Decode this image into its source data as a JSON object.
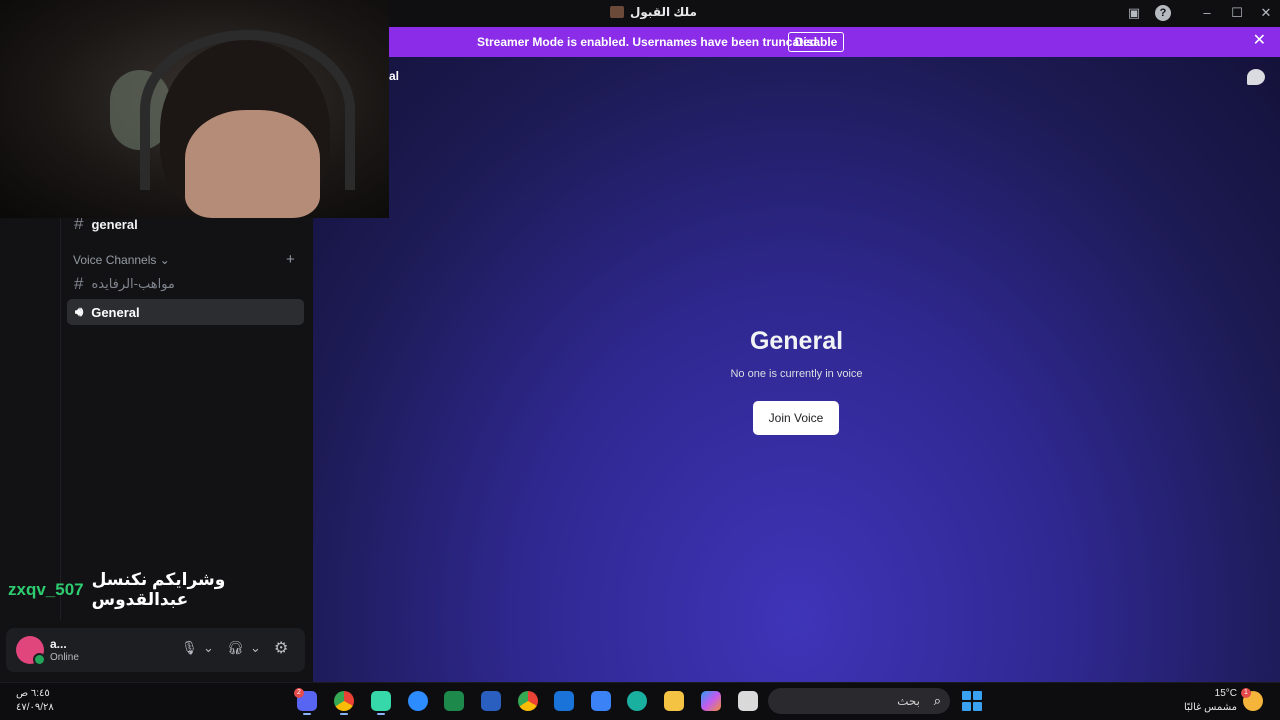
{
  "window": {
    "title": "ملك القبول"
  },
  "banner": {
    "message": "Streamer Mode is enabled. Usernames have been truncated.",
    "disable_label": "Disable",
    "color": "#8a2ce8"
  },
  "sidebar": {
    "text_channel": "general",
    "voice_header": "Voice Channels",
    "channels": [
      {
        "label": "مواهب-الرفايده",
        "type": "text"
      },
      {
        "label": "General",
        "type": "voice",
        "selected": true
      }
    ]
  },
  "overlay": {
    "username": "zxqv_507",
    "message": "وشرايكم نكنسل عبدالقدوس"
  },
  "user_panel": {
    "name": "a...",
    "status": "Online"
  },
  "main": {
    "top_fragment": "al",
    "voice_title": "General",
    "voice_subtitle": "No one is currently in voice",
    "join_label": "Join Voice"
  },
  "taskbar": {
    "time": "٦:٤٥ ص",
    "date": "٤٧/٠٩/٢٨",
    "search_placeholder": "بحث",
    "discord_badge": "2",
    "weather_temp": "15°C",
    "weather_desc": "مشمس غالبًا",
    "weather_badge": "1",
    "apps": [
      "discord-icon",
      "chrome-icon",
      "streamlabs-icon",
      "zoom-icon",
      "excel-icon",
      "word-icon",
      "chrome-icon",
      "outlook-icon",
      "store-icon",
      "edge-icon",
      "file-explorer-icon",
      "copilot-icon",
      "task-view-icon"
    ]
  }
}
